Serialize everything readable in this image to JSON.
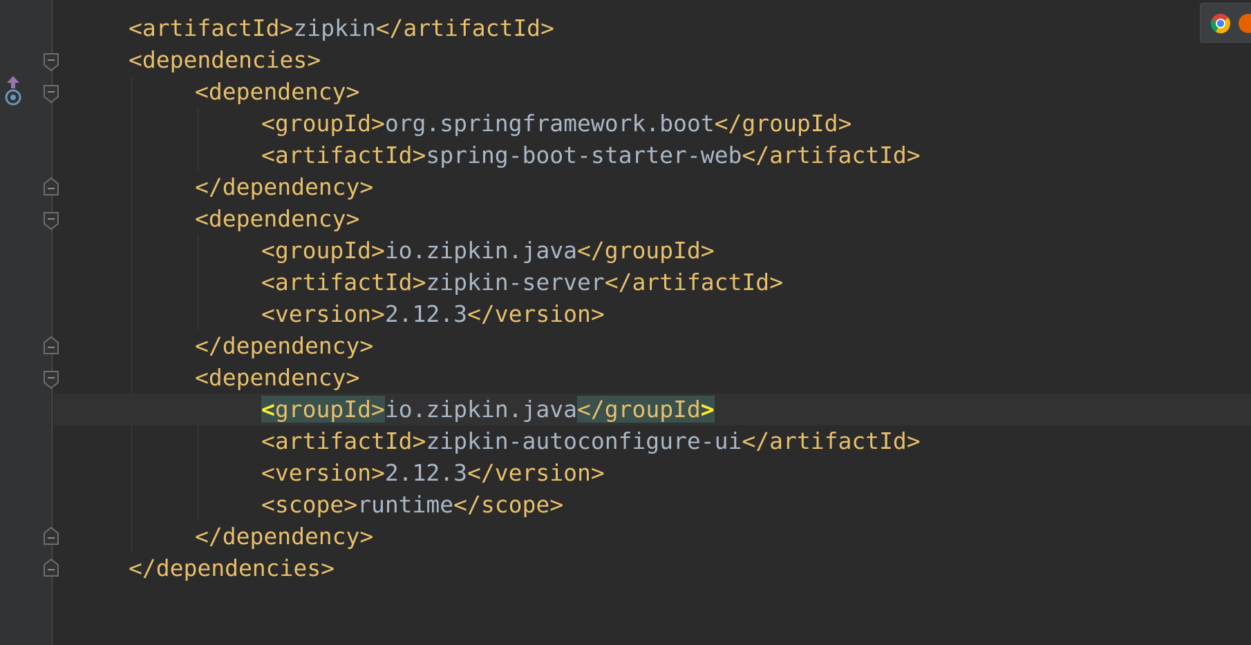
{
  "editor": {
    "language": "xml",
    "lines": [
      {
        "indent": 1,
        "open": "<artifactId>",
        "text": "zipkin",
        "close": "</artifactId>"
      },
      {
        "indent": 1,
        "open": "<dependencies>"
      },
      {
        "indent": 2,
        "open": "<dependency>"
      },
      {
        "indent": 3,
        "open": "<groupId>",
        "text": "org.springframework.boot",
        "close": "</groupId>"
      },
      {
        "indent": 3,
        "open": "<artifactId>",
        "text": "spring-boot-starter-web",
        "close": "</artifactId>"
      },
      {
        "indent": 2,
        "open": "</dependency>"
      },
      {
        "indent": 2,
        "open": "<dependency>"
      },
      {
        "indent": 3,
        "open": "<groupId>",
        "text": "io.zipkin.java",
        "close": "</groupId>"
      },
      {
        "indent": 3,
        "open": "<artifactId>",
        "text": "zipkin-server",
        "close": "</artifactId>"
      },
      {
        "indent": 3,
        "open": "<version>",
        "text": "2.12.3",
        "close": "</version>"
      },
      {
        "indent": 2,
        "open": "</dependency>"
      },
      {
        "indent": 2,
        "open": "<dependency>"
      },
      {
        "indent": 3,
        "open": "<groupId>",
        "text": "io.zipkin.java",
        "close": "</groupId>",
        "current": true
      },
      {
        "indent": 3,
        "open": "<artifactId>",
        "text": "zipkin-autoconfigure-ui",
        "close": "</artifactId>"
      },
      {
        "indent": 3,
        "open": "<version>",
        "text": "2.12.3",
        "close": "</version>"
      },
      {
        "indent": 3,
        "open": "<scope>",
        "text": "runtime",
        "close": "</scope>"
      },
      {
        "indent": 2,
        "open": "</dependency>"
      },
      {
        "indent": 1,
        "open": "</dependencies>"
      }
    ],
    "current_line": {
      "open_lt": "<",
      "open_name": "groupId>",
      "text": "io.zipkin.java",
      "close_name": "</groupId",
      "close_gt": ">"
    }
  },
  "colors": {
    "background": "#2b2b2b",
    "gutter": "#313335",
    "tag": "#e8bf6a",
    "text": "#a9b7c6",
    "tag_highlight": "#3b514d",
    "brace_match": "#ffef28",
    "current_line": "#323232"
  },
  "icons": {
    "gutter": [
      "implemented-up-arrow-icon",
      "fold-marker-icon"
    ],
    "intention": "lightbulb-icon",
    "browser_popup": [
      "chrome-icon",
      "browser-icon"
    ]
  }
}
